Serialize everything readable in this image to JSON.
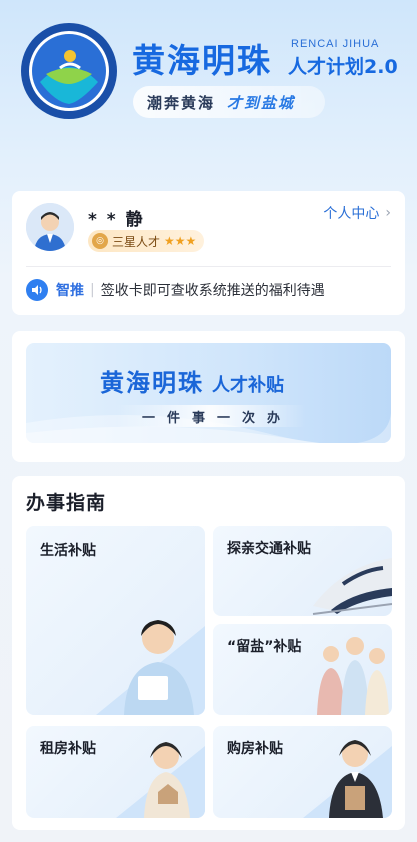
{
  "header": {
    "title": "黄海明珠",
    "english": "RENCAI JIHUA",
    "subtitle": "人才计划2.0",
    "slogan_left": "潮奔黄海",
    "slogan_right": "才到盐城",
    "emblem_icon": "talent-plan-emblem-icon",
    "brand_color": "#1769e0"
  },
  "profile": {
    "name": "* * 静",
    "badge": "三星人才",
    "stars": "★★★",
    "center_link": "个人中心",
    "push_tag": "智推",
    "push_sep": "|",
    "push_text": "签收卡即可查收系统推送的福利待遇"
  },
  "banner": {
    "title": "黄海明珠",
    "title_suffix": "人才补贴",
    "subtitle": "一件事一次办"
  },
  "guide": {
    "title": "办事指南",
    "tiles": [
      {
        "label": "生活补贴"
      },
      {
        "label": "探亲交通补贴"
      },
      {
        "label": "“留盐”补贴"
      },
      {
        "label": "租房补贴"
      },
      {
        "label": "购房补贴"
      }
    ]
  }
}
